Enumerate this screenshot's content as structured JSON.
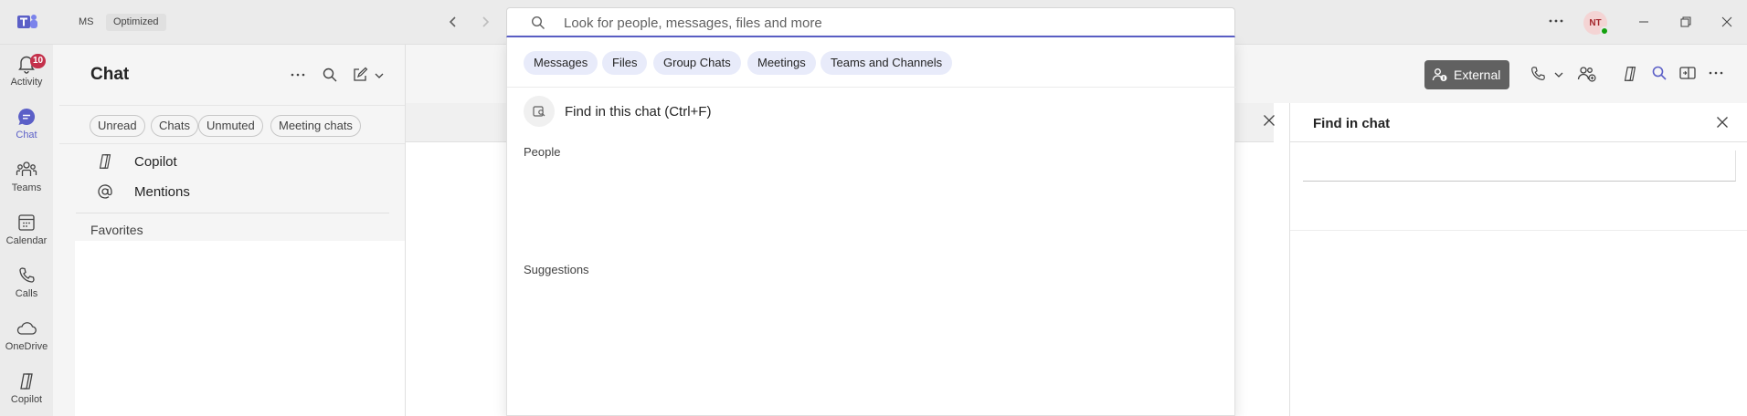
{
  "titlebar": {
    "account_label": "MS",
    "mode_label": "Optimized",
    "search_placeholder": "Look for people, messages, files and more",
    "avatar_initials": "NT"
  },
  "rail": {
    "items": [
      {
        "label": "Activity",
        "badge": "10"
      },
      {
        "label": "Chat"
      },
      {
        "label": "Teams"
      },
      {
        "label": "Calendar"
      },
      {
        "label": "Calls"
      },
      {
        "label": "OneDrive"
      },
      {
        "label": "Copilot"
      }
    ]
  },
  "chat_panel": {
    "title": "Chat",
    "filters": [
      "Unread",
      "Chats",
      "Unmuted",
      "Meeting chats"
    ],
    "copilot_label": "Copilot",
    "mentions_label": "Mentions",
    "favorites_label": "Favorites"
  },
  "main": {
    "external_label": "External",
    "find_panel_title": "Find in chat"
  },
  "search_dropdown": {
    "scopes": [
      "Messages",
      "Files",
      "Group Chats",
      "Meetings",
      "Teams and Channels"
    ],
    "find_in_chat_label": "Find in this chat (Ctrl+F)",
    "people_heading": "People",
    "suggestions_heading": "Suggestions"
  },
  "colors": {
    "accent": "#5b5fc7",
    "badge": "#c4314b",
    "presence_available": "#13a10e",
    "external_button": "#616161"
  }
}
